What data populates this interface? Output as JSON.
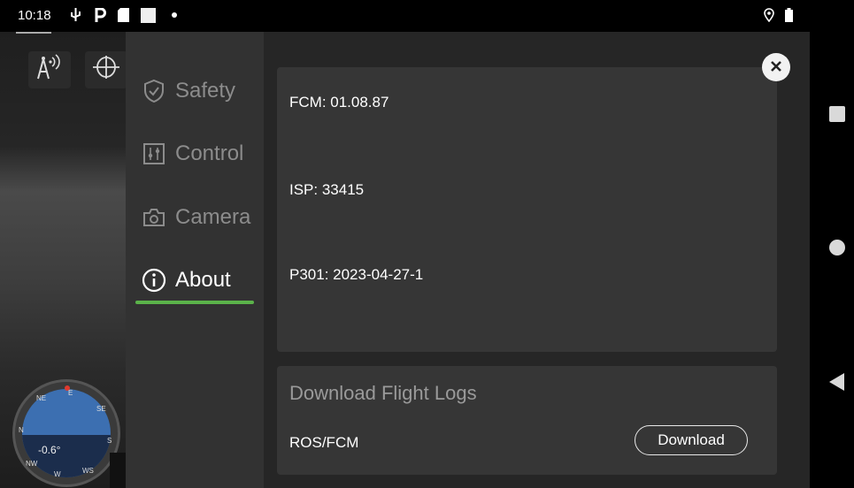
{
  "statusbar": {
    "time": "10:18",
    "icons": [
      "usb-icon",
      "parking-icon",
      "sd-card-icon",
      "blank-square-icon",
      "dot-icon",
      "location-icon",
      "battery-icon"
    ]
  },
  "camera_view": {
    "pitch_readout": "-0.6°",
    "compass_labels": [
      "NE",
      "E",
      "SE",
      "N",
      "S",
      "NW",
      "W",
      "WS"
    ],
    "tool_icons": [
      "antenna-signal-icon",
      "gimbal-icon"
    ]
  },
  "sidebar": {
    "items": [
      {
        "label": "Safety",
        "icon": "shield-check-icon",
        "active": false
      },
      {
        "label": "Control",
        "icon": "sliders-icon",
        "active": false
      },
      {
        "label": "Camera",
        "icon": "camera-icon",
        "active": false
      },
      {
        "label": "About",
        "icon": "info-icon",
        "active": true
      }
    ],
    "accent_color": "#5bb34a"
  },
  "about": {
    "versions": [
      "FCM: 01.08.87",
      "ISP: 33415",
      "P301: 2023-04-27-1"
    ],
    "flight_logs": {
      "heading": "Download Flight Logs",
      "label": "ROS/FCM",
      "button": "Download"
    },
    "close_icon": "close-icon"
  },
  "android_nav": [
    "recents-square-icon",
    "home-circle-icon",
    "back-triangle-icon"
  ]
}
